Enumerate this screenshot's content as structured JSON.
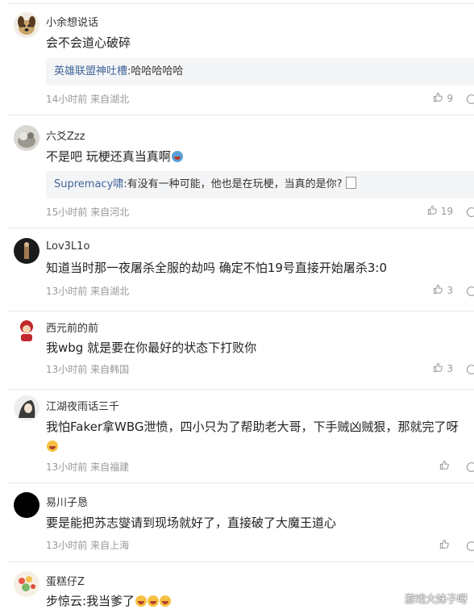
{
  "comments": [
    {
      "username": "小余想说话",
      "text": "会不会道心破碎",
      "reply": {
        "user": "英雄联盟神吐槽",
        "text": ":哈哈哈哈哈"
      },
      "meta": "14小时前 来自湖北",
      "likes": "9"
    },
    {
      "username": "六爻Zzz",
      "text": "不是吧 玩梗还真当真啊",
      "reply": {
        "user": "Supremacy啸",
        "text": ":有没有一种可能，他也是在玩梗，当真的是你?"
      },
      "meta": "15小时前 来自河北",
      "likes": "19"
    },
    {
      "username": "Lov3L1o",
      "text": "知道当时那一夜屠杀全服的劫吗 确定不怕19号直接开始屠杀3:0",
      "meta": "13小时前 来自湖北",
      "likes": "3"
    },
    {
      "username": "西元前的前",
      "text": "我wbg 就是要在你最好的状态下打败你",
      "meta": "13小时前 来自韩国",
      "likes": "3"
    },
    {
      "username": "江湖夜雨话三千",
      "text": "我怕Faker拿WBG泄愤，四小只为了帮助老大哥，下手贼凶贼狠，那就完了呀",
      "meta": "13小时前 来自福建",
      "likes": ""
    },
    {
      "username": "易川子恳",
      "text": "要是能把苏志燮请到现场就好了，直接破了大魔王道心",
      "meta": "13小时前 来自上海",
      "likes": ""
    },
    {
      "username": "蛋糕仔Z",
      "text": "步惊云:我当爹了",
      "meta": "",
      "likes": ""
    }
  ],
  "watermark": "游戏大妹子呀",
  "colors": {
    "reply_user": "#406599",
    "meta": "#999999",
    "reply_bg": "#f4f5f7"
  },
  "icons": {
    "like": "thumbs-up-icon",
    "more": "share-icon"
  }
}
